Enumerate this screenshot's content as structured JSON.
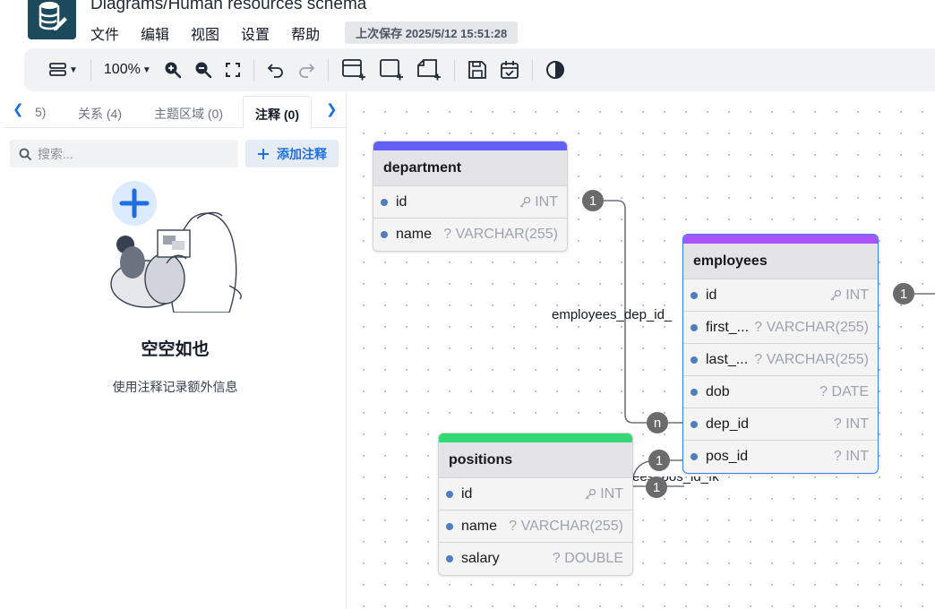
{
  "app": {
    "title": "Diagrams/Human resources schema",
    "save_status": "上次保存 2025/5/12 15:51:28"
  },
  "menu": [
    "文件",
    "编辑",
    "视图",
    "设置",
    "帮助"
  ],
  "toolbar": {
    "zoom": "100%"
  },
  "sidebar": {
    "tabs": [
      {
        "label": "5)"
      },
      {
        "label": "关系 (4)"
      },
      {
        "label": "主题区域 (0)"
      },
      {
        "label": "注释 (0)",
        "active": true
      }
    ],
    "search_placeholder": "搜索...",
    "add_note_label": "添加注释",
    "empty_title": "空空如也",
    "empty_desc": "使用注释记录额外信息"
  },
  "tables": {
    "department": {
      "name": "department",
      "color": "#6360f7",
      "fields": [
        {
          "name": "id",
          "type": "INT",
          "key": true
        },
        {
          "name": "name",
          "type": "? VARCHAR(255)"
        }
      ]
    },
    "employees": {
      "name": "employees",
      "color": "#a855f7",
      "fields": [
        {
          "name": "id",
          "type": "INT",
          "key": true
        },
        {
          "name": "first_...",
          "type": "? VARCHAR(255)"
        },
        {
          "name": "last_...",
          "type": "? VARCHAR(255)"
        },
        {
          "name": "dob",
          "type": "? DATE"
        },
        {
          "name": "dep_id",
          "type": "? INT"
        },
        {
          "name": "pos_id",
          "type": "? INT"
        }
      ]
    },
    "positions": {
      "name": "positions",
      "color": "#34d975",
      "fields": [
        {
          "name": "id",
          "type": "INT",
          "key": true
        },
        {
          "name": "name",
          "type": "? VARCHAR(255)"
        },
        {
          "name": "salary",
          "type": "? DOUBLE"
        }
      ]
    }
  },
  "relationships": {
    "dep_label": "employees_dep_id_",
    "pos_label": "ees_pos_id_fk",
    "cardinality_one": "1",
    "cardinality_many": "n"
  },
  "colors": {
    "accent": "#1d6fe0",
    "logo_bg": "#1c4a5c",
    "selected_border": "#3b7ee8",
    "badge": "#6b6b6b"
  }
}
